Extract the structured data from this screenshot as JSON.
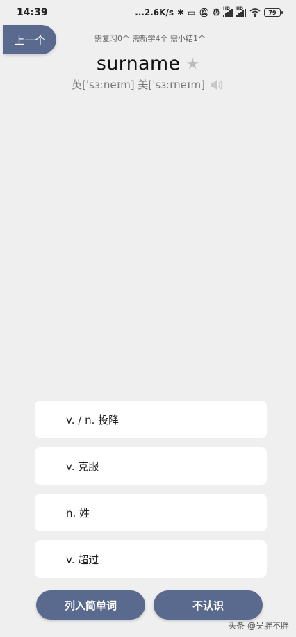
{
  "status_bar": {
    "time": "14:39",
    "network_speed": "...2.6K/s",
    "battery": "79",
    "icons": [
      "bluetooth-icon",
      "vibrate-icon",
      "mute-icon",
      "alarm-icon",
      "signal-icon",
      "signal-icon",
      "wifi-icon",
      "battery-icon"
    ]
  },
  "header": {
    "prev_label": "上一个",
    "stats": "需复习0个 需新学4个 需小结1个"
  },
  "word": {
    "text": "surname",
    "phonetic": "英[ˈsɜːneɪm] 美[ˈsɜːrneɪm]"
  },
  "options": [
    {
      "label": "v. / n. 投降"
    },
    {
      "label": "v. 克服"
    },
    {
      "label": "n. 姓"
    },
    {
      "label": "v. 超过"
    }
  ],
  "actions": {
    "easy_label": "列入简单词",
    "unknown_label": "不认识"
  },
  "watermark": "头条 @吴胖不胖",
  "colors": {
    "accent": "#5a6a8e",
    "background": "#efefef",
    "card": "#ffffff"
  }
}
